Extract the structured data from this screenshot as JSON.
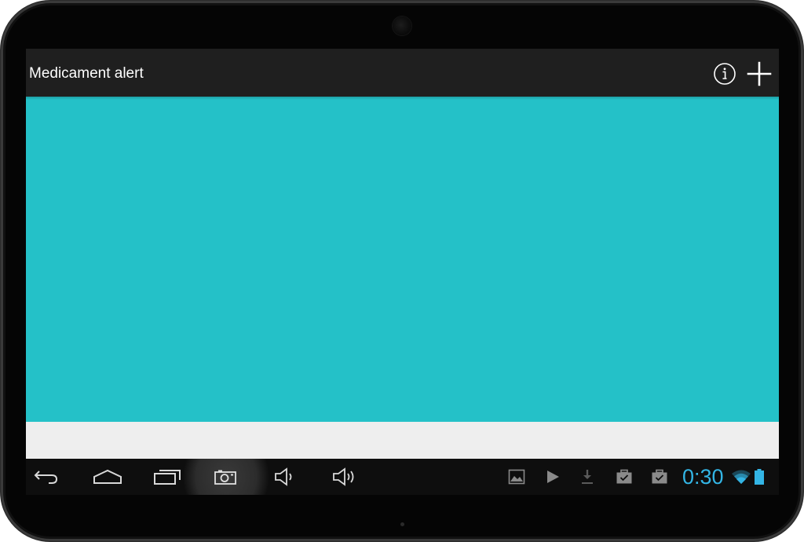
{
  "app": {
    "title": "Medicament alert"
  },
  "action_bar": {
    "info_icon": "info-circle-icon",
    "add_icon": "plus-icon"
  },
  "navigation": {
    "back_icon": "back-arrow-icon",
    "home_icon": "home-icon",
    "recents_icon": "recent-apps-icon",
    "screenshot_icon": "camera-icon",
    "volume_down_icon": "volume-down-icon",
    "volume_up_icon": "volume-up-icon"
  },
  "status_bar": {
    "time": "0:30",
    "notifications": [
      "image-icon",
      "play-store-icon",
      "download-icon",
      "briefcase-check-icon",
      "briefcase-check-icon"
    ],
    "wifi_icon": "wifi-icon",
    "battery_icon": "battery-icon"
  },
  "colors": {
    "content_background": "#24c1c8",
    "action_bar": "#1f1f1f",
    "status_accent": "#33b5e5",
    "footer_strip": "#eeeeee"
  }
}
